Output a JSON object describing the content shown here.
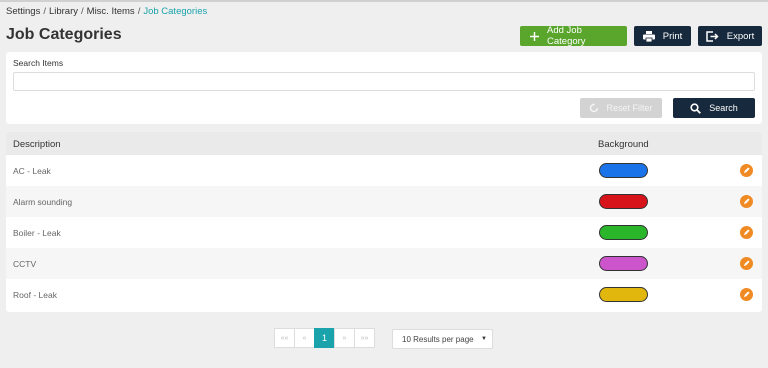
{
  "breadcrumb": {
    "items": [
      "Settings",
      "Library",
      "Misc. Items"
    ],
    "current": "Job Categories"
  },
  "page": {
    "title": "Job Categories"
  },
  "toolbar": {
    "add_label": "Add Job Category",
    "print_label": "Print",
    "export_label": "Export"
  },
  "filter": {
    "label": "Search Items",
    "value": "",
    "placeholder": "",
    "reset_label": "Reset Filter",
    "search_label": "Search"
  },
  "table": {
    "headers": {
      "description": "Description",
      "background": "Background"
    },
    "rows": [
      {
        "description": "AC - Leak",
        "color": "#1a73e8"
      },
      {
        "description": "Alarm sounding",
        "color": "#d7141a"
      },
      {
        "description": "Boiler - Leak",
        "color": "#2bb52b"
      },
      {
        "description": "CCTV",
        "color": "#cc55cc"
      },
      {
        "description": "Roof - Leak",
        "color": "#e1b70e"
      }
    ]
  },
  "pagination": {
    "first": "««",
    "prev": "«",
    "current": "1",
    "next": "»",
    "last": "»»",
    "per_page": "10 Results per page"
  },
  "colors": {
    "accent_teal": "#1aa3ab",
    "green_button": "#5aa52c",
    "dark_button": "#17293c",
    "edit_orange": "#f08a23"
  }
}
